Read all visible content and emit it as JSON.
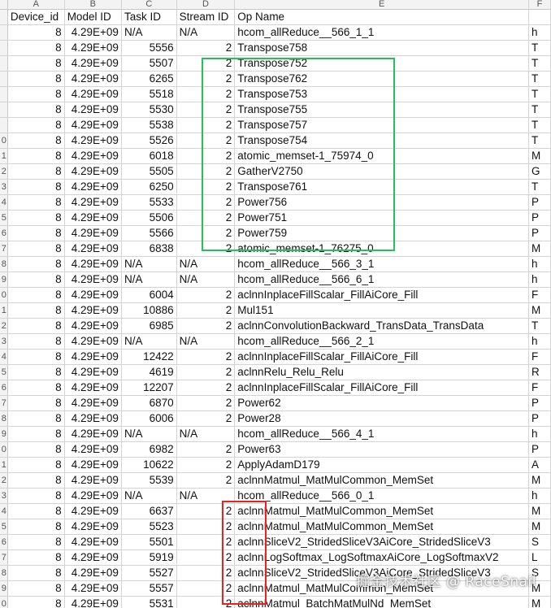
{
  "column_letters": [
    "A",
    "B",
    "C",
    "D",
    "E",
    "F"
  ],
  "headers": [
    "Device_id",
    "Model ID",
    "Task ID",
    "Stream ID",
    "Op Name",
    ""
  ],
  "row_numbers": [
    "",
    "",
    "",
    "",
    "",
    "",
    "",
    "",
    "0",
    "1",
    "2",
    "3",
    "4",
    "5",
    "6",
    "7",
    "8",
    "9",
    "0",
    "1",
    "2",
    "3",
    "4",
    "5",
    "6",
    "7",
    "8",
    "9",
    "0",
    "1",
    "2",
    "3",
    "4",
    "5",
    "6",
    "7",
    "8",
    "9",
    "0"
  ],
  "rows": [
    [
      "8",
      "4.29E+09",
      "N/A",
      "N/A",
      "hcom_allReduce__566_1_1",
      "h"
    ],
    [
      "8",
      "4.29E+09",
      "5556",
      "2",
      "Transpose758",
      "T"
    ],
    [
      "8",
      "4.29E+09",
      "5507",
      "2",
      "Transpose752",
      "T"
    ],
    [
      "8",
      "4.29E+09",
      "6265",
      "2",
      "Transpose762",
      "T"
    ],
    [
      "8",
      "4.29E+09",
      "5518",
      "2",
      "Transpose753",
      "T"
    ],
    [
      "8",
      "4.29E+09",
      "5530",
      "2",
      "Transpose755",
      "T"
    ],
    [
      "8",
      "4.29E+09",
      "5538",
      "2",
      "Transpose757",
      "T"
    ],
    [
      "8",
      "4.29E+09",
      "5526",
      "2",
      "Transpose754",
      "T"
    ],
    [
      "8",
      "4.29E+09",
      "6018",
      "2",
      "atomic_memset-1_75974_0",
      "M"
    ],
    [
      "8",
      "4.29E+09",
      "5505",
      "2",
      "GatherV2750",
      "G"
    ],
    [
      "8",
      "4.29E+09",
      "6250",
      "2",
      "Transpose761",
      "T"
    ],
    [
      "8",
      "4.29E+09",
      "5533",
      "2",
      "Power756",
      "P"
    ],
    [
      "8",
      "4.29E+09",
      "5506",
      "2",
      "Power751",
      "P"
    ],
    [
      "8",
      "4.29E+09",
      "5566",
      "2",
      "Power759",
      "P"
    ],
    [
      "8",
      "4.29E+09",
      "6838",
      "2",
      "atomic_memset-1_76275_0",
      "M"
    ],
    [
      "8",
      "4.29E+09",
      "N/A",
      "N/A",
      "hcom_allReduce__566_3_1",
      "h"
    ],
    [
      "8",
      "4.29E+09",
      "N/A",
      "N/A",
      "hcom_allReduce__566_6_1",
      "h"
    ],
    [
      "8",
      "4.29E+09",
      "6004",
      "2",
      "aclnnInplaceFillScalar_FillAiCore_Fill",
      "F"
    ],
    [
      "8",
      "4.29E+09",
      "10886",
      "2",
      "Mul151",
      "M"
    ],
    [
      "8",
      "4.29E+09",
      "6985",
      "2",
      "aclnnConvolutionBackward_TransData_TransData",
      "T"
    ],
    [
      "8",
      "4.29E+09",
      "N/A",
      "N/A",
      "hcom_allReduce__566_2_1",
      "h"
    ],
    [
      "8",
      "4.29E+09",
      "12422",
      "2",
      "aclnnInplaceFillScalar_FillAiCore_Fill",
      "F"
    ],
    [
      "8",
      "4.29E+09",
      "4619",
      "2",
      "aclnnRelu_Relu_Relu",
      "R"
    ],
    [
      "8",
      "4.29E+09",
      "12207",
      "2",
      "aclnnInplaceFillScalar_FillAiCore_Fill",
      "F"
    ],
    [
      "8",
      "4.29E+09",
      "6870",
      "2",
      "Power62",
      "P"
    ],
    [
      "8",
      "4.29E+09",
      "6006",
      "2",
      "Power28",
      "P"
    ],
    [
      "8",
      "4.29E+09",
      "N/A",
      "N/A",
      "hcom_allReduce__566_4_1",
      "h"
    ],
    [
      "8",
      "4.29E+09",
      "6982",
      "2",
      "Power63",
      "P"
    ],
    [
      "8",
      "4.29E+09",
      "10622",
      "2",
      "ApplyAdamD179",
      "A"
    ],
    [
      "8",
      "4.29E+09",
      "5539",
      "2",
      "aclnnMatmul_MatMulCommon_MemSet",
      "M"
    ],
    [
      "8",
      "4.29E+09",
      "N/A",
      "N/A",
      "hcom_allReduce__566_0_1",
      "h"
    ],
    [
      "8",
      "4.29E+09",
      "6637",
      "2",
      "aclnnMatmul_MatMulCommon_MemSet",
      "M"
    ],
    [
      "8",
      "4.29E+09",
      "5523",
      "2",
      "aclnnMatmul_MatMulCommon_MemSet",
      "M"
    ],
    [
      "8",
      "4.29E+09",
      "5501",
      "2",
      "aclnnSliceV2_StridedSliceV3AiCore_StridedSliceV3",
      "S"
    ],
    [
      "8",
      "4.29E+09",
      "5919",
      "2",
      "aclnnLogSoftmax_LogSoftmaxAiCore_LogSoftmaxV2",
      "L"
    ],
    [
      "8",
      "4.29E+09",
      "5527",
      "2",
      "aclnnSliceV2_StridedSliceV3AiCore_StridedSliceV3",
      "S"
    ],
    [
      "8",
      "4.29E+09",
      "5557",
      "2",
      "aclnnMatmul_MatMulCommon_MemSet",
      "M"
    ],
    [
      "8",
      "4.29E+09",
      "5531",
      "2",
      "aclnnMatmul_BatchMatMulNd_MemSet",
      "M"
    ]
  ],
  "watermark": "掘金技术社区 @ RaceSnail",
  "colors": {
    "green_box": "#22c25a",
    "red_box": "#e8231f"
  }
}
